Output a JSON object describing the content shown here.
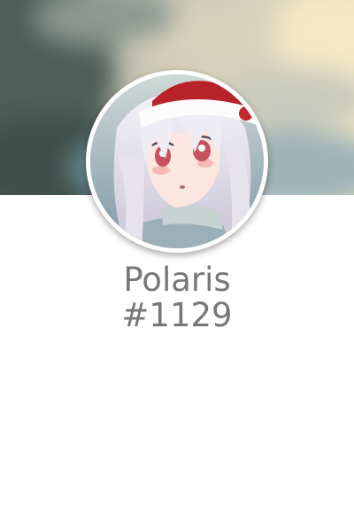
{
  "profile": {
    "username": "Polaris",
    "discriminator": "#1129"
  },
  "colors": {
    "text": "#777777",
    "background": "#ffffff",
    "avatar_border": "#ffffff"
  },
  "icons": {
    "banner": "blurred-landscape-banner-image",
    "avatar": "anime-girl-santa-hat-avatar-image"
  }
}
